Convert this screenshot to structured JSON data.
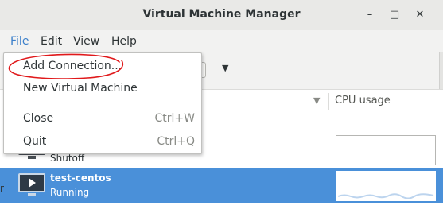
{
  "window": {
    "title": "Virtual Machine Manager",
    "controls": {
      "minimize": "–",
      "maximize": "□",
      "close": "✕"
    }
  },
  "menubar": {
    "items": [
      {
        "label": "File",
        "active": true
      },
      {
        "label": "Edit"
      },
      {
        "label": "View"
      },
      {
        "label": "Help"
      }
    ]
  },
  "file_menu": {
    "items": [
      {
        "label": "Add Connection...",
        "accel": ""
      },
      {
        "label": "New Virtual Machine",
        "accel": ""
      },
      {
        "label": "Close",
        "accel": "Ctrl+W"
      },
      {
        "label": "Quit",
        "accel": "Ctrl+Q"
      }
    ]
  },
  "list": {
    "columns": {
      "cpu_usage": "CPU usage"
    },
    "vms": [
      {
        "name": "",
        "status": "Shutoff",
        "icon": "monitor-icon"
      },
      {
        "name": "test-centos",
        "status": "Running",
        "icon": "monitor-running-icon",
        "selected": true
      }
    ]
  },
  "colors": {
    "selection": "#4a90d9",
    "menu_active": "#3b7fca",
    "annotation": "#e0191b"
  }
}
